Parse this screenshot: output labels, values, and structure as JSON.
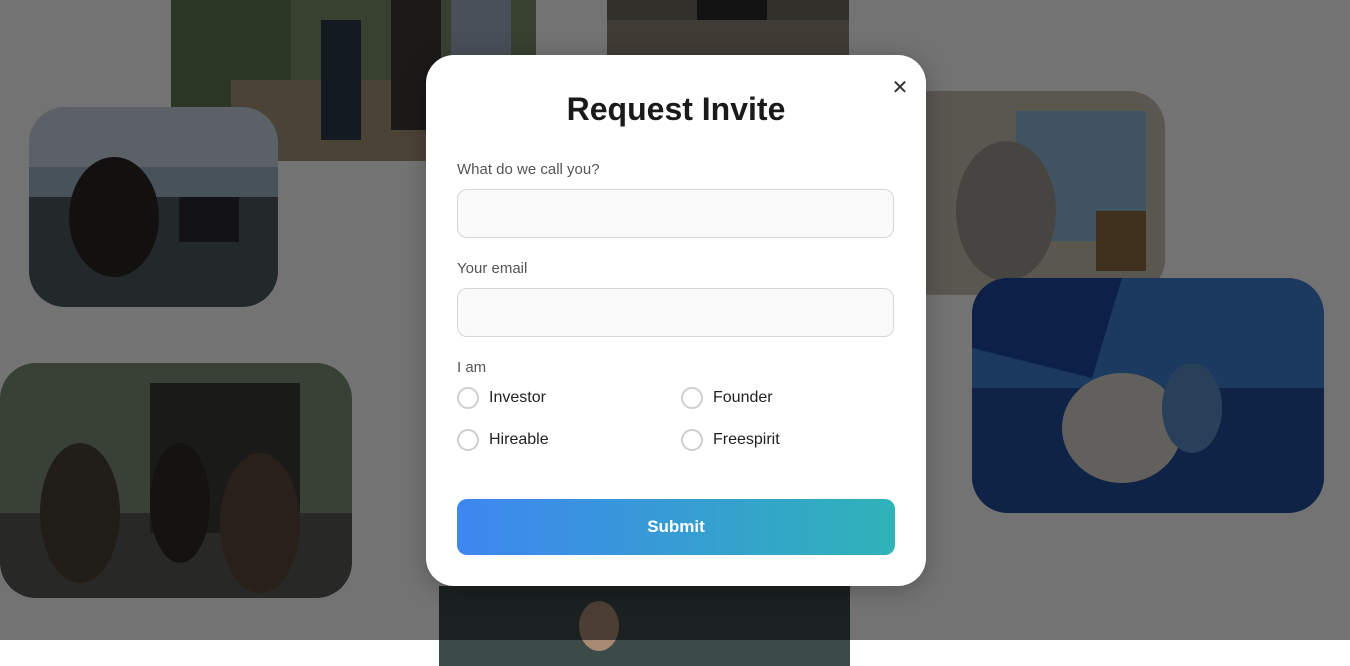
{
  "modal": {
    "title": "Request Invite",
    "close_icon": "close-icon",
    "close_glyph": "✕",
    "name_label": "What do we call you?",
    "name_value": "",
    "email_label": "Your email",
    "email_value": "",
    "role_label": "I am",
    "options": [
      "Investor",
      "Founder",
      "Hireable",
      "Freespirit"
    ],
    "submit_label": "Submit"
  },
  "colors": {
    "overlay": "rgba(0,0,0,0.55)",
    "gradient_start": "#3e86f0",
    "gradient_end": "#2fb3b8"
  }
}
